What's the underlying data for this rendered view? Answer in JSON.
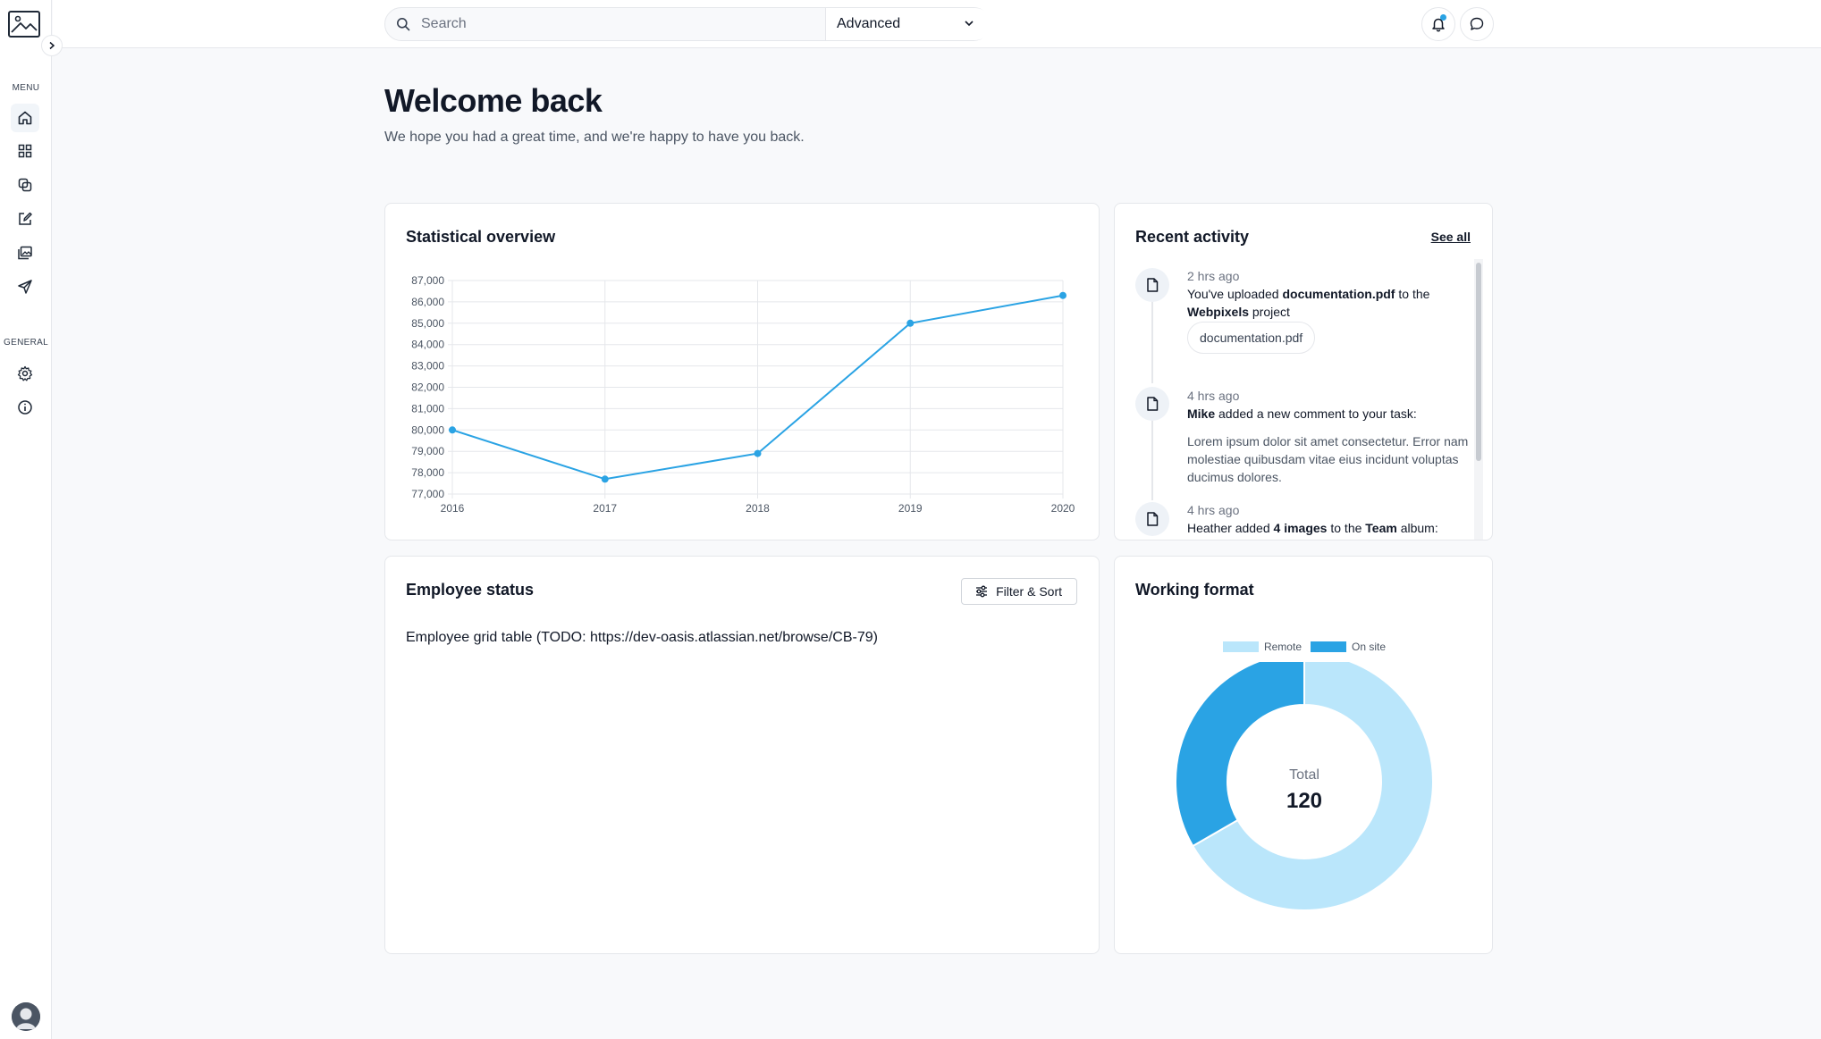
{
  "search": {
    "placeholder": "Search",
    "mode": "Advanced"
  },
  "sidebar": {
    "menu_label": "MENU",
    "general_label": "GENERAL"
  },
  "header": {
    "title": "Welcome back",
    "subtitle": "We hope you had a great time, and we're happy to have you back."
  },
  "stats": {
    "title": "Statistical overview",
    "chart_data": {
      "type": "line",
      "x": [
        "2016",
        "2017",
        "2018",
        "2019",
        "2020"
      ],
      "series": [
        {
          "values": [
            80000,
            77700,
            78900,
            85000,
            86300
          ]
        }
      ],
      "ylim": [
        77000,
        87000
      ],
      "yticks": [
        "87,000",
        "86,000",
        "85,000",
        "84,000",
        "83,000",
        "82,000",
        "81,000",
        "80,000",
        "79,000",
        "78,000",
        "77,000"
      ],
      "grid": true,
      "color": "#2aa3e4"
    }
  },
  "activity": {
    "title": "Recent activity",
    "see_all": "See all",
    "items": [
      {
        "time": "2 hrs ago",
        "text_pre": "You've uploaded ",
        "text_bold1": "documentation.pdf",
        "text_mid": " to the ",
        "text_bold2": "Webpixels",
        "text_post": " project",
        "chip": "documentation.pdf"
      },
      {
        "time": "4 hrs ago",
        "text_bold1": "Mike",
        "text_post": " added a new comment to your task:",
        "comment": "Lorem ipsum dolor sit amet consectetur. Error nam molestiae quibusdam vitae eius incidunt voluptas ducimus dolores."
      },
      {
        "time": "4 hrs ago",
        "text_pre": "Heather added ",
        "text_bold1": "4 images",
        "text_mid": " to the ",
        "text_bold2": "Team",
        "text_post": " album:"
      }
    ]
  },
  "employees": {
    "title": "Employee status",
    "filter_label": "Filter & Sort",
    "placeholder_text": "Employee grid table (TODO: https://dev-oasis.atlassian.net/browse/CB-79)"
  },
  "format": {
    "title": "Working format",
    "center_label": "Total",
    "center_value": "120",
    "chart_data": {
      "type": "pie",
      "categories": [
        "Remote",
        "On site"
      ],
      "values": [
        80,
        40
      ],
      "colors": [
        "#bae6fb",
        "#2aa3e4"
      ]
    }
  }
}
